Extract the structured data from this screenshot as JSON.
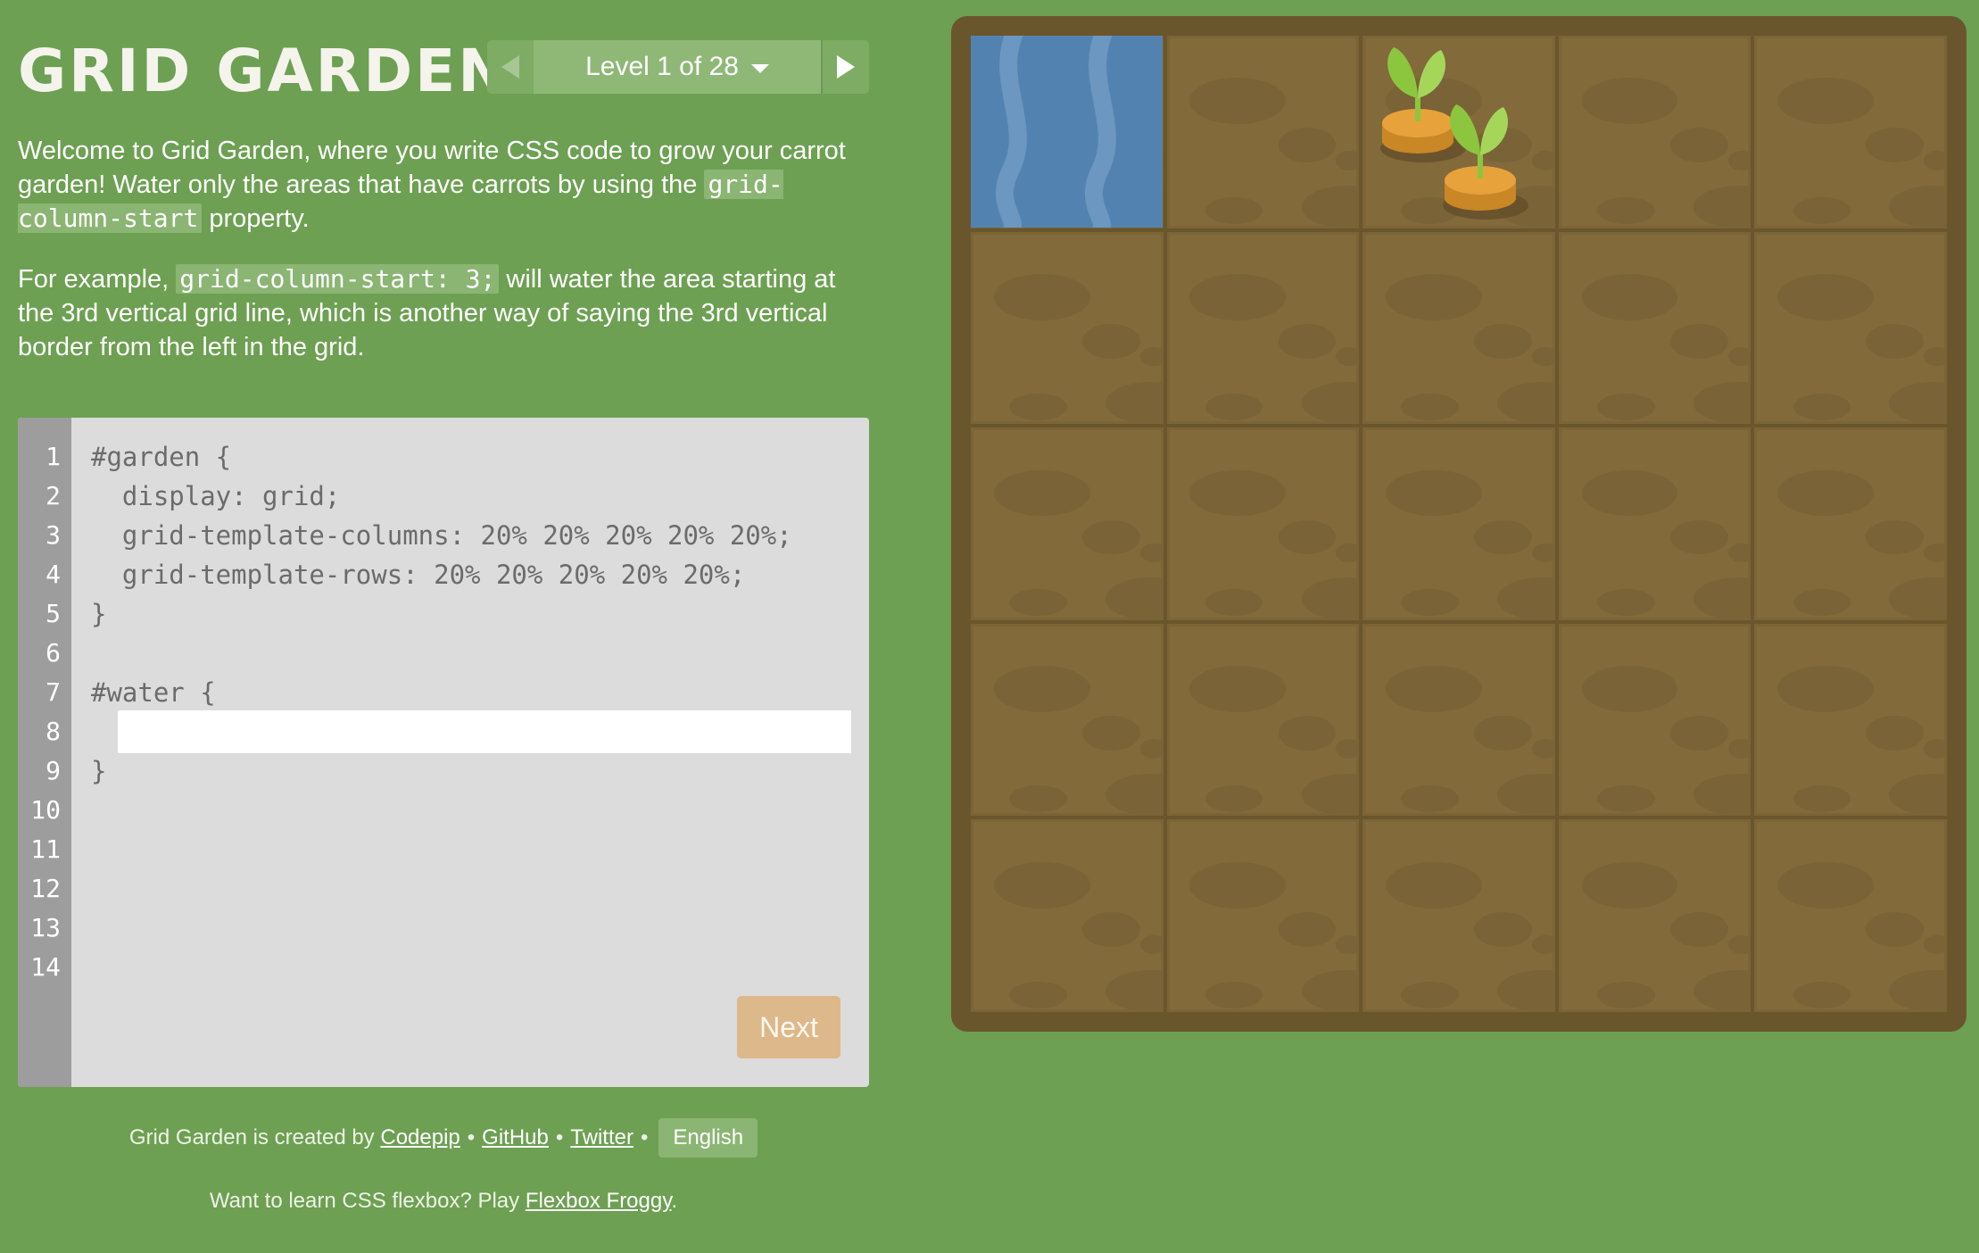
{
  "header": {
    "title": "GRID GARDEN",
    "level_label": "Level 1 of 28"
  },
  "instructions": {
    "p1_before": "Welcome to Grid Garden, where you write CSS code to grow your carrot garden! Water only the areas that have carrots by using the ",
    "p1_code": "grid-column-start",
    "p1_after": " property.",
    "p2_before": "For example, ",
    "p2_code": "grid-column-start: 3;",
    "p2_after": " will water the area starting at the 3rd vertical grid line, which is another way of saying the 3rd vertical border from the left in the grid."
  },
  "editor": {
    "line_numbers": [
      "1",
      "2",
      "3",
      "4",
      "5",
      "6",
      "7",
      "8",
      "9",
      "10",
      "11",
      "12",
      "13",
      "14"
    ],
    "lines": [
      "#garden {",
      "  display: grid;",
      "  grid-template-columns: 20% 20% 20% 20% 20%;",
      "  grid-template-rows: 20% 20% 20% 20% 20%;",
      "}",
      "",
      "#water {",
      "",
      "}"
    ],
    "input_value": "",
    "next_label": "Next"
  },
  "footer": {
    "credit_text": "Grid Garden is created by ",
    "codepip_link": "Codepip",
    "github_link": "GitHub",
    "twitter_link": "Twitter",
    "separator": "•",
    "language_label": "English",
    "promo_text": "Want to learn CSS flexbox? Play ",
    "promo_link": "Flexbox Froggy",
    "promo_end": "."
  },
  "garden": {
    "columns": 5,
    "rows": 5,
    "water_column": 1,
    "water_row": 1,
    "carrot_column": 3,
    "carrot_row": 1,
    "carrot_count": 2
  },
  "colors": {
    "background": "#6da052",
    "soil": "#826a3b",
    "board_border": "#6a562d",
    "water": "#5283b0",
    "carrot": "#e8a23c",
    "leaf": "#8cc63f",
    "next_button": "#ddb88a"
  }
}
